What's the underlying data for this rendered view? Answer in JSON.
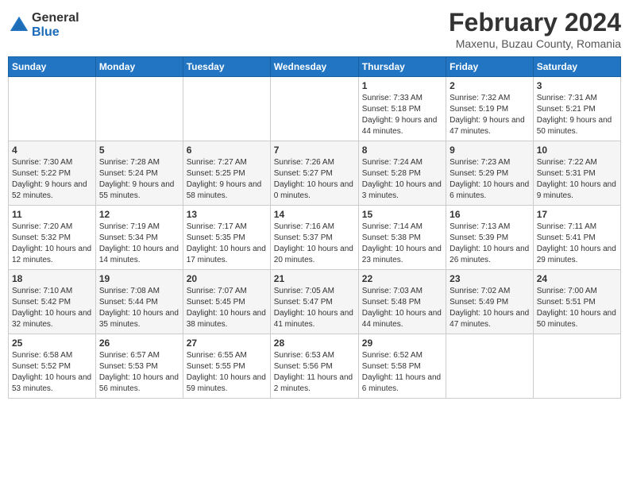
{
  "logo": {
    "general": "General",
    "blue": "Blue"
  },
  "title": "February 2024",
  "subtitle": "Maxenu, Buzau County, Romania",
  "weekdays": [
    "Sunday",
    "Monday",
    "Tuesday",
    "Wednesday",
    "Thursday",
    "Friday",
    "Saturday"
  ],
  "weeks": [
    [
      {
        "day": "",
        "info": ""
      },
      {
        "day": "",
        "info": ""
      },
      {
        "day": "",
        "info": ""
      },
      {
        "day": "",
        "info": ""
      },
      {
        "day": "1",
        "sunrise": "Sunrise: 7:33 AM",
        "sunset": "Sunset: 5:18 PM",
        "daylight": "Daylight: 9 hours and 44 minutes."
      },
      {
        "day": "2",
        "sunrise": "Sunrise: 7:32 AM",
        "sunset": "Sunset: 5:19 PM",
        "daylight": "Daylight: 9 hours and 47 minutes."
      },
      {
        "day": "3",
        "sunrise": "Sunrise: 7:31 AM",
        "sunset": "Sunset: 5:21 PM",
        "daylight": "Daylight: 9 hours and 50 minutes."
      }
    ],
    [
      {
        "day": "4",
        "sunrise": "Sunrise: 7:30 AM",
        "sunset": "Sunset: 5:22 PM",
        "daylight": "Daylight: 9 hours and 52 minutes."
      },
      {
        "day": "5",
        "sunrise": "Sunrise: 7:28 AM",
        "sunset": "Sunset: 5:24 PM",
        "daylight": "Daylight: 9 hours and 55 minutes."
      },
      {
        "day": "6",
        "sunrise": "Sunrise: 7:27 AM",
        "sunset": "Sunset: 5:25 PM",
        "daylight": "Daylight: 9 hours and 58 minutes."
      },
      {
        "day": "7",
        "sunrise": "Sunrise: 7:26 AM",
        "sunset": "Sunset: 5:27 PM",
        "daylight": "Daylight: 10 hours and 0 minutes."
      },
      {
        "day": "8",
        "sunrise": "Sunrise: 7:24 AM",
        "sunset": "Sunset: 5:28 PM",
        "daylight": "Daylight: 10 hours and 3 minutes."
      },
      {
        "day": "9",
        "sunrise": "Sunrise: 7:23 AM",
        "sunset": "Sunset: 5:29 PM",
        "daylight": "Daylight: 10 hours and 6 minutes."
      },
      {
        "day": "10",
        "sunrise": "Sunrise: 7:22 AM",
        "sunset": "Sunset: 5:31 PM",
        "daylight": "Daylight: 10 hours and 9 minutes."
      }
    ],
    [
      {
        "day": "11",
        "sunrise": "Sunrise: 7:20 AM",
        "sunset": "Sunset: 5:32 PM",
        "daylight": "Daylight: 10 hours and 12 minutes."
      },
      {
        "day": "12",
        "sunrise": "Sunrise: 7:19 AM",
        "sunset": "Sunset: 5:34 PM",
        "daylight": "Daylight: 10 hours and 14 minutes."
      },
      {
        "day": "13",
        "sunrise": "Sunrise: 7:17 AM",
        "sunset": "Sunset: 5:35 PM",
        "daylight": "Daylight: 10 hours and 17 minutes."
      },
      {
        "day": "14",
        "sunrise": "Sunrise: 7:16 AM",
        "sunset": "Sunset: 5:37 PM",
        "daylight": "Daylight: 10 hours and 20 minutes."
      },
      {
        "day": "15",
        "sunrise": "Sunrise: 7:14 AM",
        "sunset": "Sunset: 5:38 PM",
        "daylight": "Daylight: 10 hours and 23 minutes."
      },
      {
        "day": "16",
        "sunrise": "Sunrise: 7:13 AM",
        "sunset": "Sunset: 5:39 PM",
        "daylight": "Daylight: 10 hours and 26 minutes."
      },
      {
        "day": "17",
        "sunrise": "Sunrise: 7:11 AM",
        "sunset": "Sunset: 5:41 PM",
        "daylight": "Daylight: 10 hours and 29 minutes."
      }
    ],
    [
      {
        "day": "18",
        "sunrise": "Sunrise: 7:10 AM",
        "sunset": "Sunset: 5:42 PM",
        "daylight": "Daylight: 10 hours and 32 minutes."
      },
      {
        "day": "19",
        "sunrise": "Sunrise: 7:08 AM",
        "sunset": "Sunset: 5:44 PM",
        "daylight": "Daylight: 10 hours and 35 minutes."
      },
      {
        "day": "20",
        "sunrise": "Sunrise: 7:07 AM",
        "sunset": "Sunset: 5:45 PM",
        "daylight": "Daylight: 10 hours and 38 minutes."
      },
      {
        "day": "21",
        "sunrise": "Sunrise: 7:05 AM",
        "sunset": "Sunset: 5:47 PM",
        "daylight": "Daylight: 10 hours and 41 minutes."
      },
      {
        "day": "22",
        "sunrise": "Sunrise: 7:03 AM",
        "sunset": "Sunset: 5:48 PM",
        "daylight": "Daylight: 10 hours and 44 minutes."
      },
      {
        "day": "23",
        "sunrise": "Sunrise: 7:02 AM",
        "sunset": "Sunset: 5:49 PM",
        "daylight": "Daylight: 10 hours and 47 minutes."
      },
      {
        "day": "24",
        "sunrise": "Sunrise: 7:00 AM",
        "sunset": "Sunset: 5:51 PM",
        "daylight": "Daylight: 10 hours and 50 minutes."
      }
    ],
    [
      {
        "day": "25",
        "sunrise": "Sunrise: 6:58 AM",
        "sunset": "Sunset: 5:52 PM",
        "daylight": "Daylight: 10 hours and 53 minutes."
      },
      {
        "day": "26",
        "sunrise": "Sunrise: 6:57 AM",
        "sunset": "Sunset: 5:53 PM",
        "daylight": "Daylight: 10 hours and 56 minutes."
      },
      {
        "day": "27",
        "sunrise": "Sunrise: 6:55 AM",
        "sunset": "Sunset: 5:55 PM",
        "daylight": "Daylight: 10 hours and 59 minutes."
      },
      {
        "day": "28",
        "sunrise": "Sunrise: 6:53 AM",
        "sunset": "Sunset: 5:56 PM",
        "daylight": "Daylight: 11 hours and 2 minutes."
      },
      {
        "day": "29",
        "sunrise": "Sunrise: 6:52 AM",
        "sunset": "Sunset: 5:58 PM",
        "daylight": "Daylight: 11 hours and 6 minutes."
      },
      {
        "day": "",
        "info": ""
      },
      {
        "day": "",
        "info": ""
      }
    ]
  ]
}
